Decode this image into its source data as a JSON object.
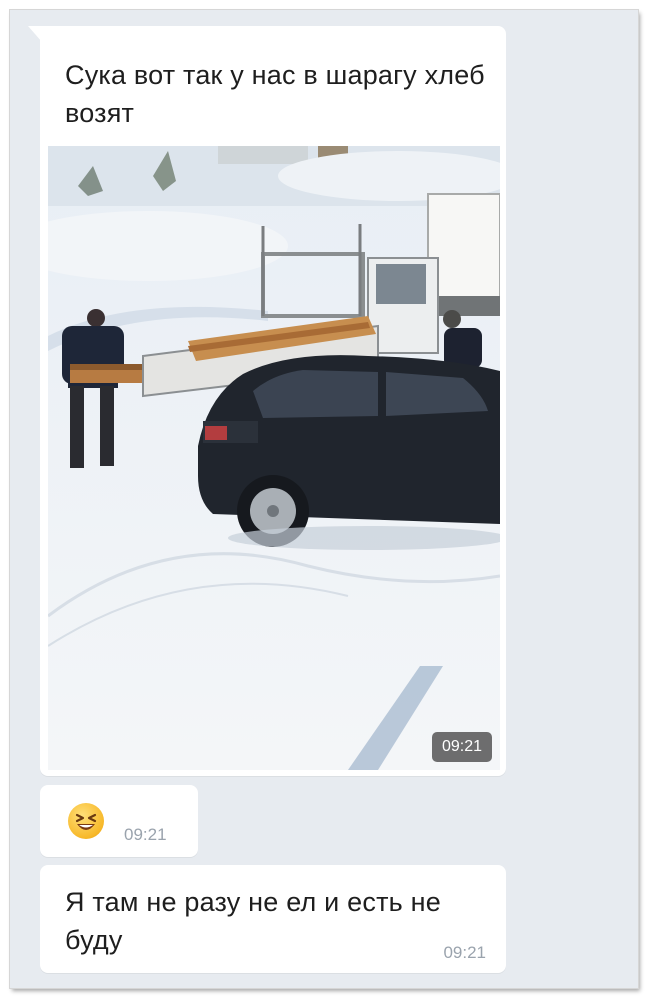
{
  "messages": [
    {
      "text": "Сука вот так у нас в шарагу хлеб возят",
      "photo_time": "09:21"
    },
    {
      "emoji": "laughing-face-emoji",
      "time": "09:21"
    },
    {
      "text": "Я там не разу не ел и есть не буду",
      "time": "09:21"
    }
  ],
  "colors": {
    "chat_bg": "#e7ebf0",
    "bubble": "#ffffff",
    "time": "#9aa3ad"
  }
}
